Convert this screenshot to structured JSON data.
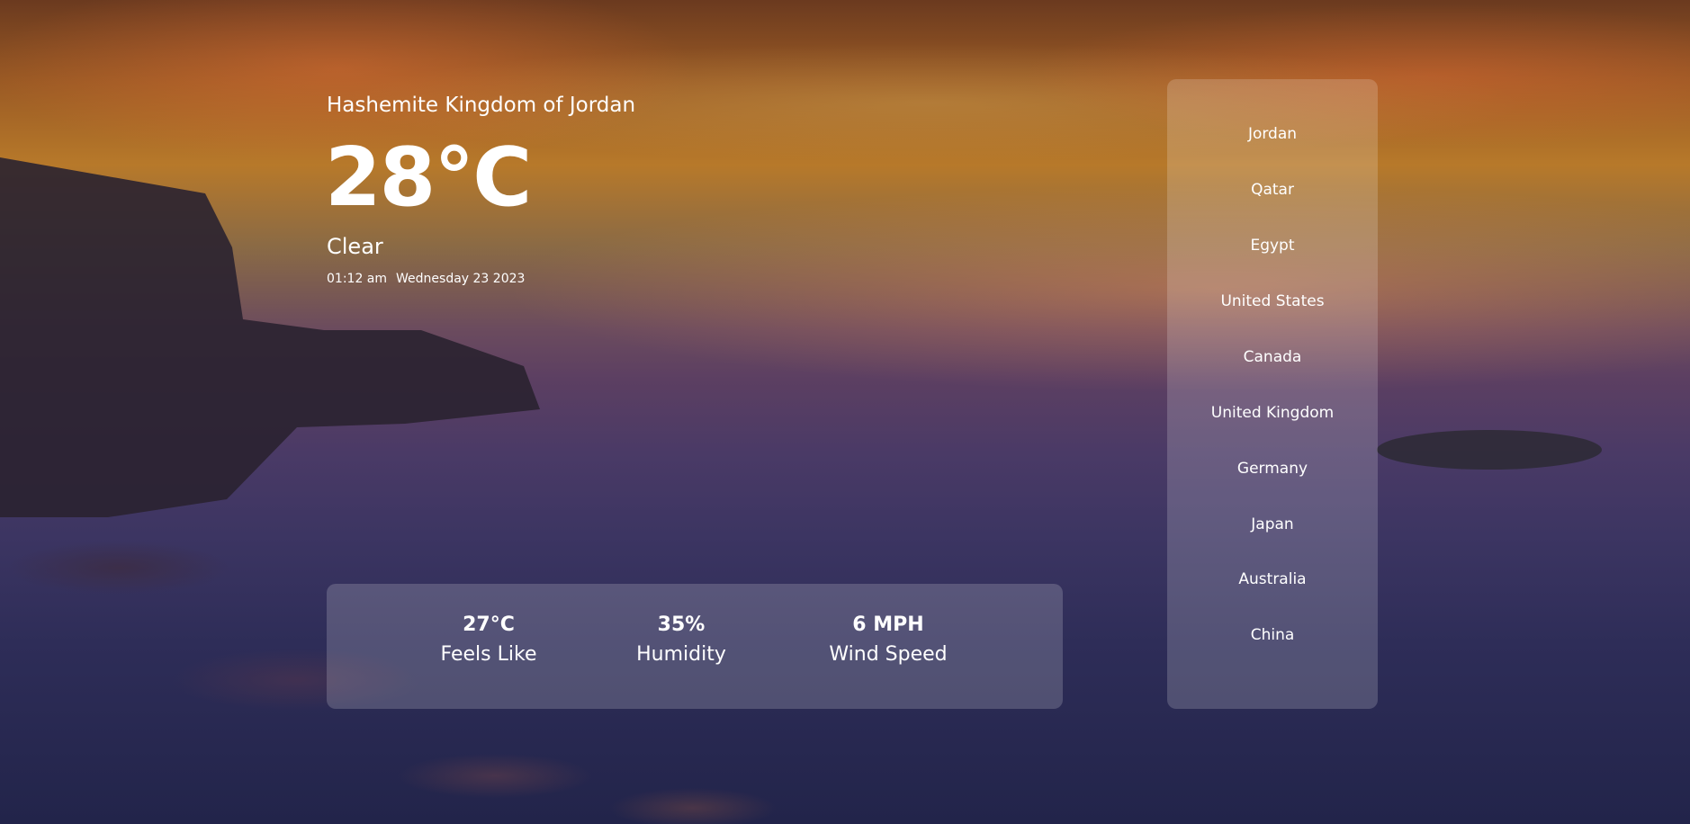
{
  "location": "Hashemite Kingdom of Jordan",
  "temperature": "28°C",
  "condition": "Clear",
  "time": "01:12 am",
  "date": "Wednesday 23 2023",
  "stats": [
    {
      "value": "27°C",
      "label": "Feels Like"
    },
    {
      "value": "35%",
      "label": "Humidity"
    },
    {
      "value": "6 MPH",
      "label": "Wind Speed"
    }
  ],
  "countries": [
    "Jordan",
    "Qatar",
    "Egypt",
    "United States",
    "Canada",
    "United Kingdom",
    "Germany",
    "Japan",
    "Australia",
    "China"
  ]
}
